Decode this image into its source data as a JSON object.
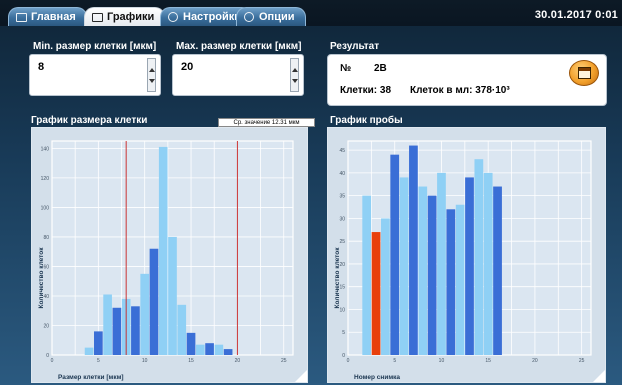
{
  "tabs": [
    {
      "label": "Главная",
      "icon": "home-icon",
      "active": false
    },
    {
      "label": "Графики",
      "icon": "chart-icon",
      "active": true
    },
    {
      "label": "Настройки",
      "icon": "gear-icon",
      "active": false
    },
    {
      "label": "Опции",
      "icon": "options-icon",
      "active": false
    }
  ],
  "datetime": "30.01.2017 0:01",
  "min_size": {
    "label": "Min. размер клетки [мкм]",
    "value": "8"
  },
  "max_size": {
    "label": "Max. размер клетки [мкм]",
    "value": "20"
  },
  "result": {
    "title": "Результат",
    "no_label": "№",
    "no_value": "2B",
    "cells_text": "Клетки: 38",
    "per_ml_text": "Клеток в мл: 378·10³"
  },
  "colors": {
    "bar_light": "#8fd0f5",
    "bar_dark": "#3a6ed6",
    "bar_highlight": "#e8400c",
    "limit_line": "#c82020"
  },
  "chart_data": [
    {
      "type": "bar",
      "title": "График размера клетки",
      "mean_label": "Ср. значение 12.31 мкм",
      "xlabel": "Размер клетки [мкм]",
      "ylabel": "Количество клеток",
      "xlim": [
        0,
        26
      ],
      "ylim": [
        0,
        145
      ],
      "x_ticks": [
        0,
        5,
        10,
        15,
        20,
        25
      ],
      "y_ticks": [
        0,
        20,
        40,
        60,
        80,
        100,
        120,
        140
      ],
      "x_tick_labels": [
        "0",
        "5",
        "10",
        "15",
        "20",
        "25"
      ],
      "y_tick_labels": [
        "0",
        "20",
        "40",
        "60",
        "80",
        "100",
        "120",
        "140"
      ],
      "limit_lines": [
        8,
        20
      ],
      "bins": [
        {
          "x": 4,
          "value": 5,
          "shade": "light"
        },
        {
          "x": 5,
          "value": 16,
          "shade": "dark"
        },
        {
          "x": 6,
          "value": 41,
          "shade": "light"
        },
        {
          "x": 7,
          "value": 32,
          "shade": "dark"
        },
        {
          "x": 8,
          "value": 38,
          "shade": "light"
        },
        {
          "x": 9,
          "value": 33,
          "shade": "dark"
        },
        {
          "x": 10,
          "value": 55,
          "shade": "light"
        },
        {
          "x": 11,
          "value": 72,
          "shade": "dark"
        },
        {
          "x": 12,
          "value": 141,
          "shade": "light"
        },
        {
          "x": 13,
          "value": 80,
          "shade": "light"
        },
        {
          "x": 14,
          "value": 34,
          "shade": "light"
        },
        {
          "x": 15,
          "value": 15,
          "shade": "dark"
        },
        {
          "x": 16,
          "value": 7,
          "shade": "light"
        },
        {
          "x": 17,
          "value": 8,
          "shade": "dark"
        },
        {
          "x": 18,
          "value": 7,
          "shade": "light"
        },
        {
          "x": 19,
          "value": 4,
          "shade": "dark"
        }
      ]
    },
    {
      "type": "bar",
      "title": "График пробы",
      "xlabel": "Номер снимка",
      "ylabel": "Количество клеток",
      "xlim": [
        0,
        26
      ],
      "ylim": [
        0,
        47
      ],
      "x_ticks": [
        0,
        5,
        10,
        15,
        20,
        25
      ],
      "y_ticks": [
        0,
        5,
        10,
        15,
        20,
        25,
        30,
        35,
        40,
        45
      ],
      "x_tick_labels": [
        "0",
        "5",
        "10",
        "15",
        "20",
        "25"
      ],
      "y_tick_labels": [
        "0",
        "5",
        "10",
        "15",
        "20",
        "25",
        "30",
        "35",
        "40",
        "45"
      ],
      "bars": [
        {
          "x": 2,
          "value": 35,
          "shade": "light"
        },
        {
          "x": 3,
          "value": 27,
          "shade": "highlight"
        },
        {
          "x": 4,
          "value": 30,
          "shade": "light"
        },
        {
          "x": 5,
          "value": 44,
          "shade": "dark"
        },
        {
          "x": 6,
          "value": 39,
          "shade": "light"
        },
        {
          "x": 7,
          "value": 46,
          "shade": "dark"
        },
        {
          "x": 8,
          "value": 37,
          "shade": "light"
        },
        {
          "x": 9,
          "value": 35,
          "shade": "dark"
        },
        {
          "x": 10,
          "value": 40,
          "shade": "light"
        },
        {
          "x": 11,
          "value": 32,
          "shade": "dark"
        },
        {
          "x": 12,
          "value": 33,
          "shade": "light"
        },
        {
          "x": 13,
          "value": 39,
          "shade": "dark"
        },
        {
          "x": 14,
          "value": 43,
          "shade": "light"
        },
        {
          "x": 15,
          "value": 40,
          "shade": "light"
        },
        {
          "x": 16,
          "value": 37,
          "shade": "dark"
        }
      ]
    }
  ]
}
